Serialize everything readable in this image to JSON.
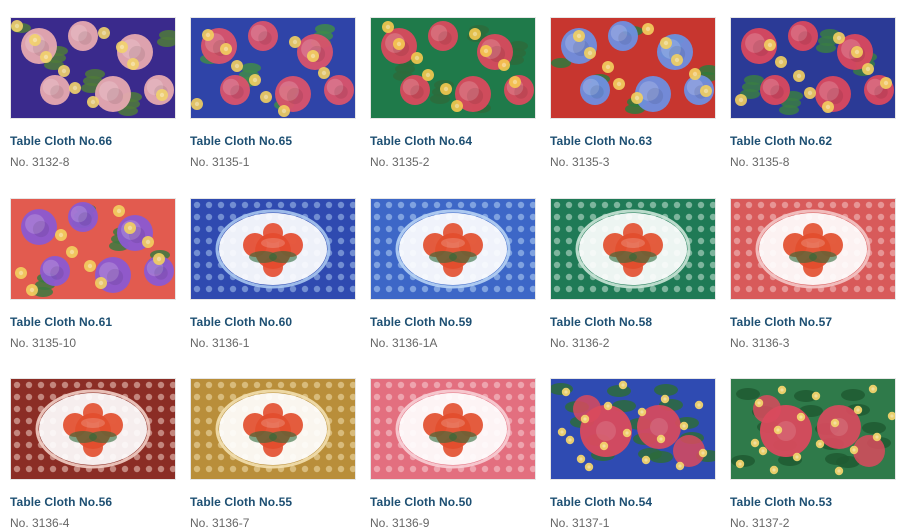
{
  "products": [
    {
      "title": "Table Cloth No.66",
      "code": "No. 3132-8",
      "pattern": "floral",
      "bg": "#3a2a8c",
      "flower": "#e6a9b0",
      "accent": "#f2d36b",
      "leaf": "#4f7a3a"
    },
    {
      "title": "Table Cloth No.65",
      "code": "No. 3135-1",
      "pattern": "floral",
      "bg": "#2f44a8",
      "flower": "#d9536c",
      "accent": "#f3d05f",
      "leaf": "#3f8a4a"
    },
    {
      "title": "Table Cloth No.64",
      "code": "No. 3135-2",
      "pattern": "floral",
      "bg": "#1f7a4a",
      "flower": "#d94a5d",
      "accent": "#f6c94f",
      "leaf": "#2d6b3b"
    },
    {
      "title": "Table Cloth No.63",
      "code": "No. 3135-3",
      "pattern": "floral",
      "bg": "#c7362f",
      "flower": "#6f8fe0",
      "accent": "#f3d05f",
      "leaf": "#2f7a3c"
    },
    {
      "title": "Table Cloth No.62",
      "code": "No. 3135-8",
      "pattern": "floral",
      "bg": "#2b3a96",
      "flower": "#d9485e",
      "accent": "#f3d05f",
      "leaf": "#3a7d44"
    },
    {
      "title": "Table Cloth No.61",
      "code": "No. 3135-10",
      "pattern": "floral",
      "bg": "#e25b4f",
      "flower": "#8b5ad1",
      "accent": "#f3d05f",
      "leaf": "#3b7a3f"
    },
    {
      "title": "Table Cloth No.60",
      "code": "No. 3136-1",
      "pattern": "medallion",
      "bg": "#2f4ab0",
      "flower": "#e44b2f",
      "accent": "#a9c7ef",
      "leaf": "#2d6b3b"
    },
    {
      "title": "Table Cloth No.59",
      "code": "No. 3136-1A",
      "pattern": "medallion",
      "bg": "#3d67c7",
      "flower": "#e24e2e",
      "accent": "#b7d3f4",
      "leaf": "#2d6b3b"
    },
    {
      "title": "Table Cloth No.58",
      "code": "No. 3136-2",
      "pattern": "medallion",
      "bg": "#1f7a56",
      "flower": "#e24e2e",
      "accent": "#cbe6d8",
      "leaf": "#2d6b3b"
    },
    {
      "title": "Table Cloth No.57",
      "code": "No. 3136-3",
      "pattern": "medallion",
      "bg": "#d85a5a",
      "flower": "#e24e2e",
      "accent": "#f4c7c7",
      "leaf": "#2d6b3b"
    },
    {
      "title": "Table Cloth No.56",
      "code": "No. 3136-4",
      "pattern": "medallion",
      "bg": "#8b2d25",
      "flower": "#e24e2e",
      "accent": "#f2cfc6",
      "leaf": "#2d6b3b"
    },
    {
      "title": "Table Cloth No.55",
      "code": "No. 3136-7",
      "pattern": "medallion",
      "bg": "#b98e3a",
      "flower": "#e24e2e",
      "accent": "#f3e0b0",
      "leaf": "#2d6b3b"
    },
    {
      "title": "Table Cloth No.50",
      "code": "No. 3136-9",
      "pattern": "medallion",
      "bg": "#e36f7f",
      "flower": "#e24e2e",
      "accent": "#f7cfd6",
      "leaf": "#2d6b3b"
    },
    {
      "title": "Table Cloth No.54",
      "code": "No. 3137-1",
      "pattern": "rose",
      "bg": "#2f4bb2",
      "flower": "#d94a5d",
      "accent": "#f2d36b",
      "leaf": "#2d6b3b"
    },
    {
      "title": "Table Cloth No.53",
      "code": "No. 3137-2",
      "pattern": "rose",
      "bg": "#2f7a4a",
      "flower": "#d94a5d",
      "accent": "#f2d36b",
      "leaf": "#1f5a31"
    }
  ]
}
